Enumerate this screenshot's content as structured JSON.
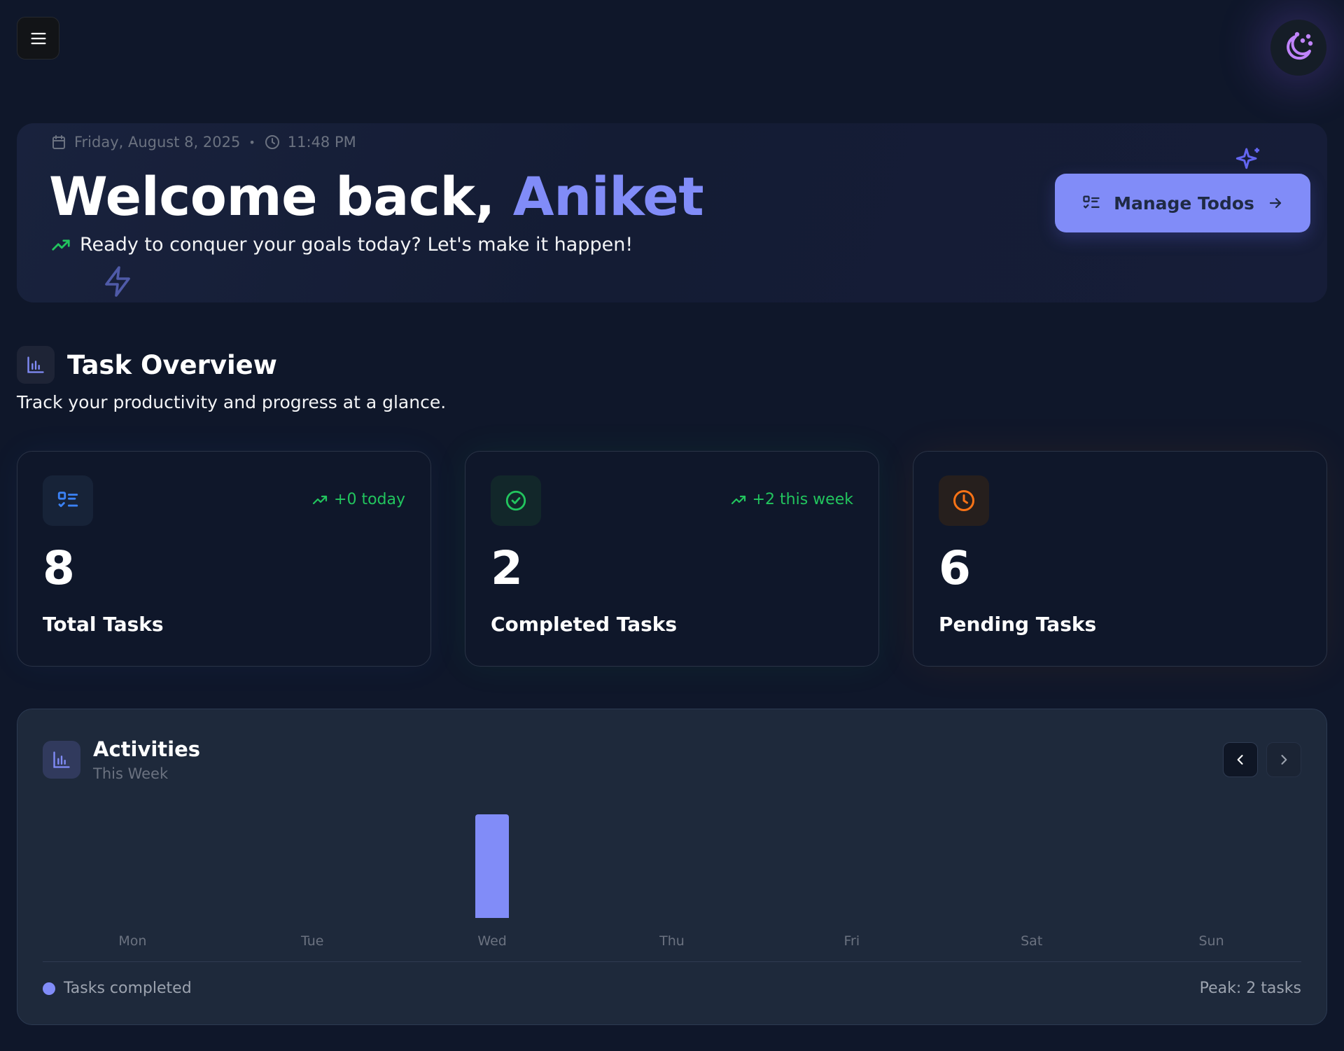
{
  "header": {
    "menu_icon": "hamburger-menu-icon",
    "theme_icon": "moon-stars-icon"
  },
  "hero": {
    "date": "Friday, August 8, 2025",
    "separator": "•",
    "time": "11:48 PM",
    "greeting": "Welcome back, ",
    "user_name": "Aniket",
    "subtitle": "Ready to conquer your goals today? Let's make it happen!",
    "manage_button_label": "Manage Todos",
    "accent_color": "#818cf8"
  },
  "overview": {
    "title": "Task Overview",
    "subtitle": "Track your productivity and progress at a glance."
  },
  "stats": [
    {
      "value": "8",
      "label": "Total Tasks",
      "trend": "+0 today",
      "icon": "list-check-icon",
      "color": "#3b82f6"
    },
    {
      "value": "2",
      "label": "Completed Tasks",
      "trend": "+2 this week",
      "icon": "check-circle-icon",
      "color": "#22c55e"
    },
    {
      "value": "6",
      "label": "Pending Tasks",
      "trend": "",
      "icon": "clock-icon",
      "color": "#f97316"
    }
  ],
  "activities": {
    "title": "Activities",
    "period": "This Week",
    "legend_label": "Tasks completed",
    "peak_label": "Peak: 2 tasks"
  },
  "chart_data": {
    "type": "bar",
    "categories": [
      "Mon",
      "Tue",
      "Wed",
      "Thu",
      "Fri",
      "Sat",
      "Sun"
    ],
    "values": [
      0,
      0,
      2,
      0,
      0,
      0,
      0
    ],
    "series": [
      {
        "name": "Tasks completed",
        "values": [
          0,
          0,
          2,
          0,
          0,
          0,
          0
        ]
      }
    ],
    "ylim": [
      0,
      2
    ],
    "grid": false,
    "legend": "bottom-left",
    "color": "#818cf8"
  }
}
